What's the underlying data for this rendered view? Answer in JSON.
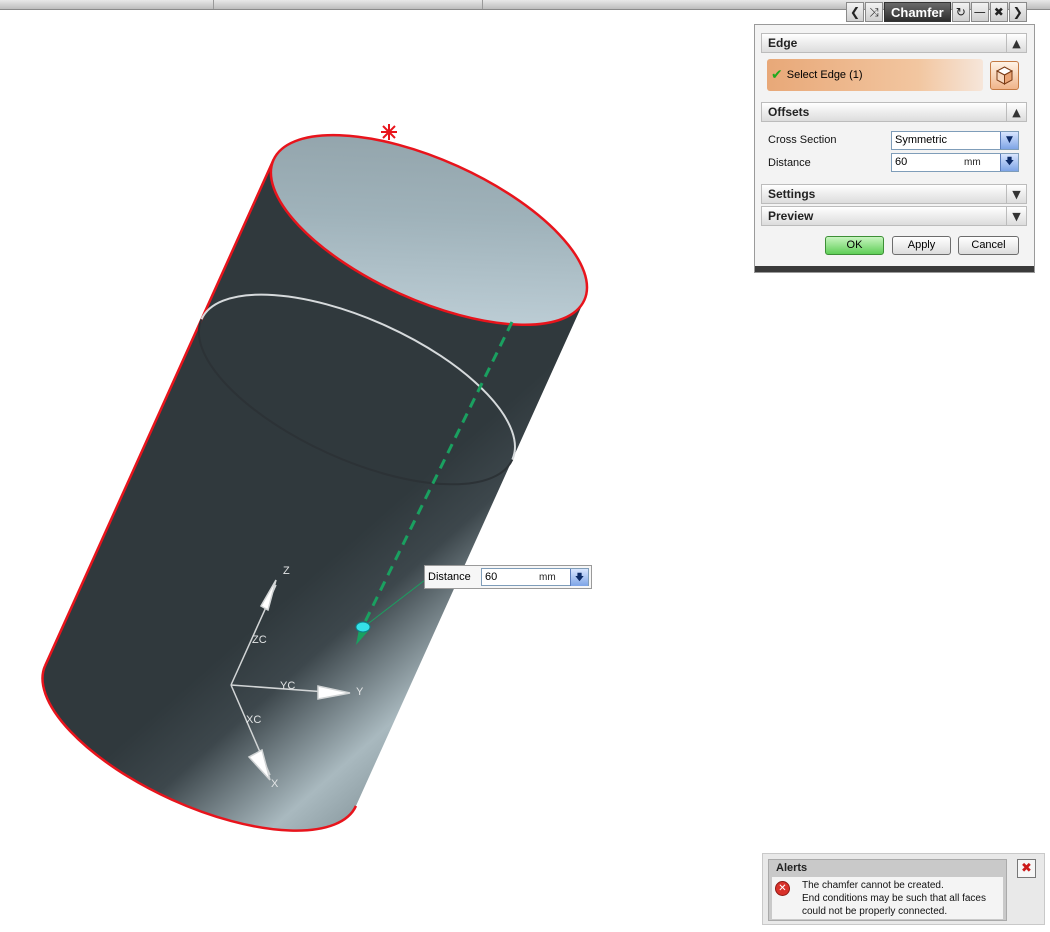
{
  "dialog": {
    "title": "Chamfer",
    "icons": {
      "prev": "chevron-left-icon",
      "pin": "pin-icon",
      "reset": "reset-icon",
      "minimize": "minimize-icon",
      "close": "close-icon",
      "next": "chevron-right-icon"
    },
    "groups": {
      "edge": {
        "label": "Edge",
        "state": "expanded"
      },
      "offsets": {
        "label": "Offsets",
        "state": "expanded"
      },
      "settings": {
        "label": "Settings",
        "state": "collapsed"
      },
      "preview": {
        "label": "Preview",
        "state": "collapsed"
      }
    },
    "select_edge_label": "Select Edge (1)",
    "cross_section": {
      "label": "Cross Section",
      "value": "Symmetric"
    },
    "distance": {
      "label": "Distance",
      "value": "60",
      "unit": "mm"
    },
    "buttons": {
      "ok": "OK",
      "apply": "Apply",
      "cancel": "Cancel"
    }
  },
  "graphics": {
    "distance_label": "Distance",
    "distance_value": "60",
    "distance_unit": "mm",
    "triad": {
      "z": "Z",
      "zc": "ZC",
      "y": "Y",
      "yc": "YC",
      "x": "X",
      "xc": "XC"
    }
  },
  "alerts": {
    "title": "Alerts",
    "lines": [
      "The chamfer cannot be created.",
      "End conditions may be such that all faces",
      "could not be properly connected."
    ]
  },
  "colors": {
    "highlight_edge": "#e8141c",
    "select_row": "#f0b88a",
    "ok_button": "#6fd466",
    "vector": "#1aa060"
  }
}
